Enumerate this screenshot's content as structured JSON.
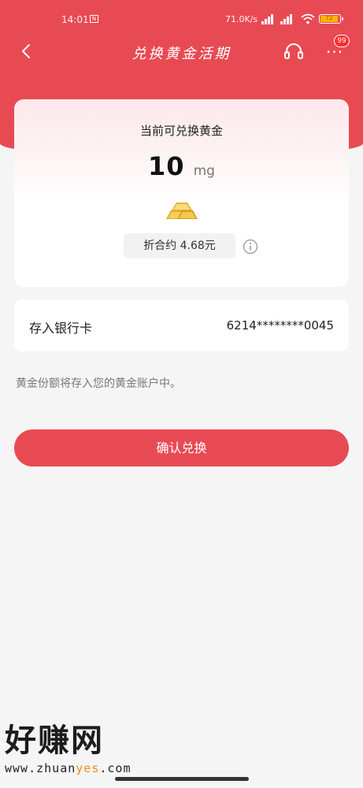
{
  "status_bar": {
    "time": "14:01",
    "sim_icon": "sim-card-icon",
    "net_speed": "71.0K/s",
    "battery": "72"
  },
  "nav": {
    "title": "兑换黄金活期",
    "back_icon": "chevron-left-icon",
    "service_icon": "headset-icon",
    "more_icon": "more-dots-icon",
    "badge": "99"
  },
  "gold": {
    "label": "当前可兑换黄金",
    "amount": "10",
    "unit": "mg",
    "equivalent": "折合约 4.68元",
    "icon": "gold-bar-icon"
  },
  "bank": {
    "label": "存入银行卡",
    "card_number": "6214********0045"
  },
  "note": "黄金份额将存入您的黄金账户中。",
  "confirm_button": "确认兑换",
  "watermark": {
    "title": "好赚网",
    "url_prefix": "www.zhuan",
    "url_highlight": "yes",
    "url_suffix": ".com"
  },
  "colors": {
    "primary": "#e84a54",
    "background": "#f5f5f5",
    "gold": "#f2c14e"
  }
}
